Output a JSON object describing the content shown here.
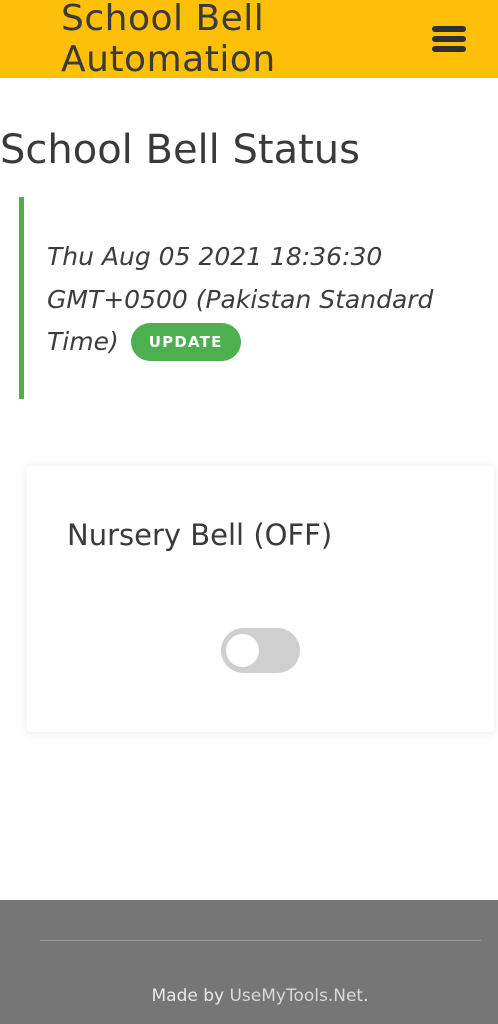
{
  "header": {
    "brand_line1": "School Bell",
    "brand_line2": "Automation",
    "menu_icon": "hamburger-menu-icon",
    "background_color": "#fdbf08"
  },
  "main": {
    "page_title": "School Bell Status",
    "datetime": "Thu Aug 05 2021 18:36:30 GMT+0500 (Pakistan Standard Time)",
    "update_label": "UPDATE",
    "accent_color": "#4caf50"
  },
  "bells": [
    {
      "title": "Nursery Bell (OFF)",
      "on": false
    }
  ],
  "footer": {
    "made_by": "Made by ",
    "link_text": "UseMyTools.Net",
    "suffix": "."
  }
}
